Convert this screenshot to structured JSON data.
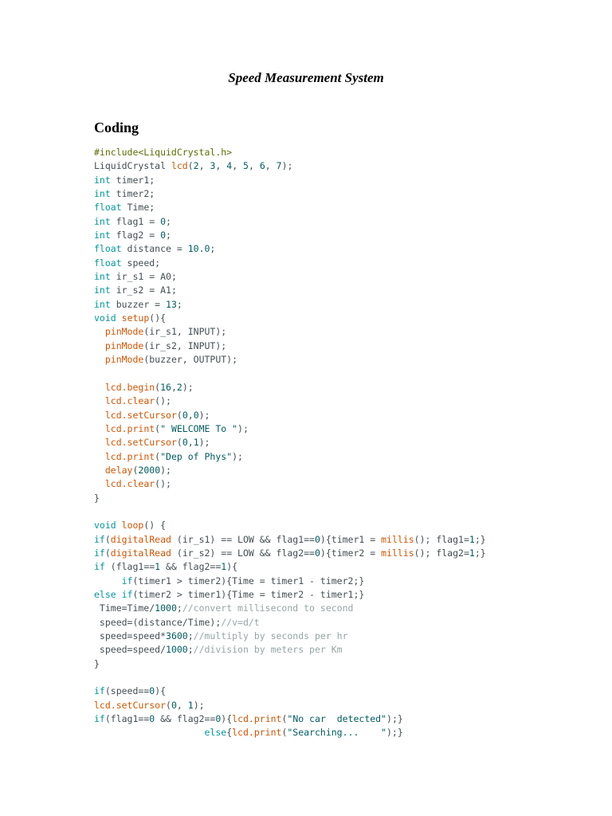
{
  "document": {
    "title": "Speed Measurement System",
    "section_heading": "Coding"
  },
  "colors": {
    "keyword": "#00979c",
    "function": "#d35400",
    "number": "#005c5f",
    "string": "#005c5f",
    "comment": "#95a5a6",
    "preprocessor": "#5e6d03",
    "plain": "#434f54"
  },
  "code_lines": [
    [
      [
        "pre",
        "#include<LiquidCrystal.h>"
      ]
    ],
    [
      [
        "plain",
        "LiquidCrystal "
      ],
      [
        "fn",
        "lcd"
      ],
      [
        "plain",
        "("
      ],
      [
        "num",
        "2"
      ],
      [
        "plain",
        ", "
      ],
      [
        "num",
        "3"
      ],
      [
        "plain",
        ", "
      ],
      [
        "num",
        "4"
      ],
      [
        "plain",
        ", "
      ],
      [
        "num",
        "5"
      ],
      [
        "plain",
        ", "
      ],
      [
        "num",
        "6"
      ],
      [
        "plain",
        ", "
      ],
      [
        "num",
        "7"
      ],
      [
        "plain",
        ");"
      ]
    ],
    [
      [
        "kw",
        "int"
      ],
      [
        "plain",
        " timer1;"
      ]
    ],
    [
      [
        "kw",
        "int"
      ],
      [
        "plain",
        " timer2;"
      ]
    ],
    [
      [
        "kw",
        "float"
      ],
      [
        "plain",
        " Time;"
      ]
    ],
    [
      [
        "kw",
        "int"
      ],
      [
        "plain",
        " flag1 = "
      ],
      [
        "num",
        "0"
      ],
      [
        "plain",
        ";"
      ]
    ],
    [
      [
        "kw",
        "int"
      ],
      [
        "plain",
        " flag2 = "
      ],
      [
        "num",
        "0"
      ],
      [
        "plain",
        ";"
      ]
    ],
    [
      [
        "kw",
        "float"
      ],
      [
        "plain",
        " distance = "
      ],
      [
        "num",
        "10.0"
      ],
      [
        "plain",
        ";"
      ]
    ],
    [
      [
        "kw",
        "float"
      ],
      [
        "plain",
        " speed;"
      ]
    ],
    [
      [
        "kw",
        "int"
      ],
      [
        "plain",
        " ir_s1 = A0;"
      ]
    ],
    [
      [
        "kw",
        "int"
      ],
      [
        "plain",
        " ir_s2 = A1;"
      ]
    ],
    [
      [
        "kw",
        "int"
      ],
      [
        "plain",
        " buzzer = "
      ],
      [
        "num",
        "13"
      ],
      [
        "plain",
        ";"
      ]
    ],
    [
      [
        "kw",
        "void"
      ],
      [
        "plain",
        " "
      ],
      [
        "fn",
        "setup"
      ],
      [
        "plain",
        "(){"
      ]
    ],
    [
      [
        "plain",
        "  "
      ],
      [
        "fn",
        "pinMode"
      ],
      [
        "plain",
        "(ir_s1, INPUT);"
      ]
    ],
    [
      [
        "plain",
        "  "
      ],
      [
        "fn",
        "pinMode"
      ],
      [
        "plain",
        "(ir_s2, INPUT);"
      ]
    ],
    [
      [
        "plain",
        "  "
      ],
      [
        "fn",
        "pinMode"
      ],
      [
        "plain",
        "(buzzer, OUTPUT);"
      ]
    ],
    [],
    [
      [
        "plain",
        "  "
      ],
      [
        "fn",
        "lcd.begin"
      ],
      [
        "plain",
        "("
      ],
      [
        "num",
        "16"
      ],
      [
        "plain",
        ","
      ],
      [
        "num",
        "2"
      ],
      [
        "plain",
        ");"
      ]
    ],
    [
      [
        "plain",
        "  "
      ],
      [
        "fn",
        "lcd.clear"
      ],
      [
        "plain",
        "();"
      ]
    ],
    [
      [
        "plain",
        "  "
      ],
      [
        "fn",
        "lcd.setCursor"
      ],
      [
        "plain",
        "("
      ],
      [
        "num",
        "0"
      ],
      [
        "plain",
        ","
      ],
      [
        "num",
        "0"
      ],
      [
        "plain",
        ");"
      ]
    ],
    [
      [
        "plain",
        "  "
      ],
      [
        "fn",
        "lcd.print"
      ],
      [
        "plain",
        "("
      ],
      [
        "str",
        "\" WELCOME To \""
      ],
      [
        "plain",
        ");"
      ]
    ],
    [
      [
        "plain",
        "  "
      ],
      [
        "fn",
        "lcd.setCursor"
      ],
      [
        "plain",
        "("
      ],
      [
        "num",
        "0"
      ],
      [
        "plain",
        ","
      ],
      [
        "num",
        "1"
      ],
      [
        "plain",
        ");"
      ]
    ],
    [
      [
        "plain",
        "  "
      ],
      [
        "fn",
        "lcd.print"
      ],
      [
        "plain",
        "("
      ],
      [
        "str",
        "\"Dep of Phys\""
      ],
      [
        "plain",
        ");"
      ]
    ],
    [
      [
        "plain",
        "  "
      ],
      [
        "fn",
        "delay"
      ],
      [
        "plain",
        "("
      ],
      [
        "num",
        "2000"
      ],
      [
        "plain",
        ");"
      ]
    ],
    [
      [
        "plain",
        "  "
      ],
      [
        "fn",
        "lcd.clear"
      ],
      [
        "plain",
        "();"
      ]
    ],
    [
      [
        "plain",
        "}"
      ]
    ],
    [],
    [
      [
        "kw",
        "void"
      ],
      [
        "plain",
        " "
      ],
      [
        "fn",
        "loop"
      ],
      [
        "plain",
        "() {"
      ]
    ],
    [
      [
        "kw",
        "if"
      ],
      [
        "plain",
        "("
      ],
      [
        "fn",
        "digitalRead"
      ],
      [
        "plain",
        " (ir_s1) == LOW && flag1=="
      ],
      [
        "num",
        "0"
      ],
      [
        "plain",
        "){timer1 = "
      ],
      [
        "fn",
        "millis"
      ],
      [
        "plain",
        "(); flag1="
      ],
      [
        "num",
        "1"
      ],
      [
        "plain",
        ";}"
      ]
    ],
    [
      [
        "kw",
        "if"
      ],
      [
        "plain",
        "("
      ],
      [
        "fn",
        "digitalRead"
      ],
      [
        "plain",
        " (ir_s2) == LOW && flag2=="
      ],
      [
        "num",
        "0"
      ],
      [
        "plain",
        "){timer2 = "
      ],
      [
        "fn",
        "millis"
      ],
      [
        "plain",
        "(); flag2="
      ],
      [
        "num",
        "1"
      ],
      [
        "plain",
        ";}"
      ]
    ],
    [
      [
        "kw",
        "if"
      ],
      [
        "plain",
        " (flag1=="
      ],
      [
        "num",
        "1"
      ],
      [
        "plain",
        " && flag2=="
      ],
      [
        "num",
        "1"
      ],
      [
        "plain",
        "){"
      ]
    ],
    [
      [
        "plain",
        "     "
      ],
      [
        "kw",
        "if"
      ],
      [
        "plain",
        "(timer1 > timer2){Time = timer1 - timer2;}"
      ]
    ],
    [
      [
        "kw",
        "else"
      ],
      [
        "plain",
        " "
      ],
      [
        "kw",
        "if"
      ],
      [
        "plain",
        "(timer2 > timer1){Time = timer2 - timer1;}"
      ]
    ],
    [
      [
        "plain",
        " Time=Time/"
      ],
      [
        "num",
        "1000"
      ],
      [
        "plain",
        ";"
      ],
      [
        "com",
        "//convert millisecond to second"
      ]
    ],
    [
      [
        "plain",
        " speed=(distance/Time);"
      ],
      [
        "com",
        "//v=d/t"
      ]
    ],
    [
      [
        "plain",
        " speed=speed*"
      ],
      [
        "num",
        "3600"
      ],
      [
        "plain",
        ";"
      ],
      [
        "com",
        "//multiply by seconds per hr"
      ]
    ],
    [
      [
        "plain",
        " speed=speed/"
      ],
      [
        "num",
        "1000"
      ],
      [
        "plain",
        ";"
      ],
      [
        "com",
        "//division by meters per Km"
      ]
    ],
    [
      [
        "plain",
        "}"
      ]
    ],
    [],
    [
      [
        "kw",
        "if"
      ],
      [
        "plain",
        "(speed=="
      ],
      [
        "num",
        "0"
      ],
      [
        "plain",
        "){"
      ]
    ],
    [
      [
        "fn",
        "lcd.setCursor"
      ],
      [
        "plain",
        "("
      ],
      [
        "num",
        "0"
      ],
      [
        "plain",
        ", "
      ],
      [
        "num",
        "1"
      ],
      [
        "plain",
        ");"
      ]
    ],
    [
      [
        "kw",
        "if"
      ],
      [
        "plain",
        "(flag1=="
      ],
      [
        "num",
        "0"
      ],
      [
        "plain",
        " && flag2=="
      ],
      [
        "num",
        "0"
      ],
      [
        "plain",
        "){"
      ],
      [
        "fn",
        "lcd.print"
      ],
      [
        "plain",
        "("
      ],
      [
        "str",
        "\"No car  detected\""
      ],
      [
        "plain",
        ");}"
      ]
    ],
    [
      [
        "plain",
        "                    "
      ],
      [
        "kw",
        "else"
      ],
      [
        "plain",
        "{"
      ],
      [
        "fn",
        "lcd.print"
      ],
      [
        "plain",
        "("
      ],
      [
        "str",
        "\"Searching...    \""
      ],
      [
        "plain",
        ");}"
      ]
    ]
  ]
}
